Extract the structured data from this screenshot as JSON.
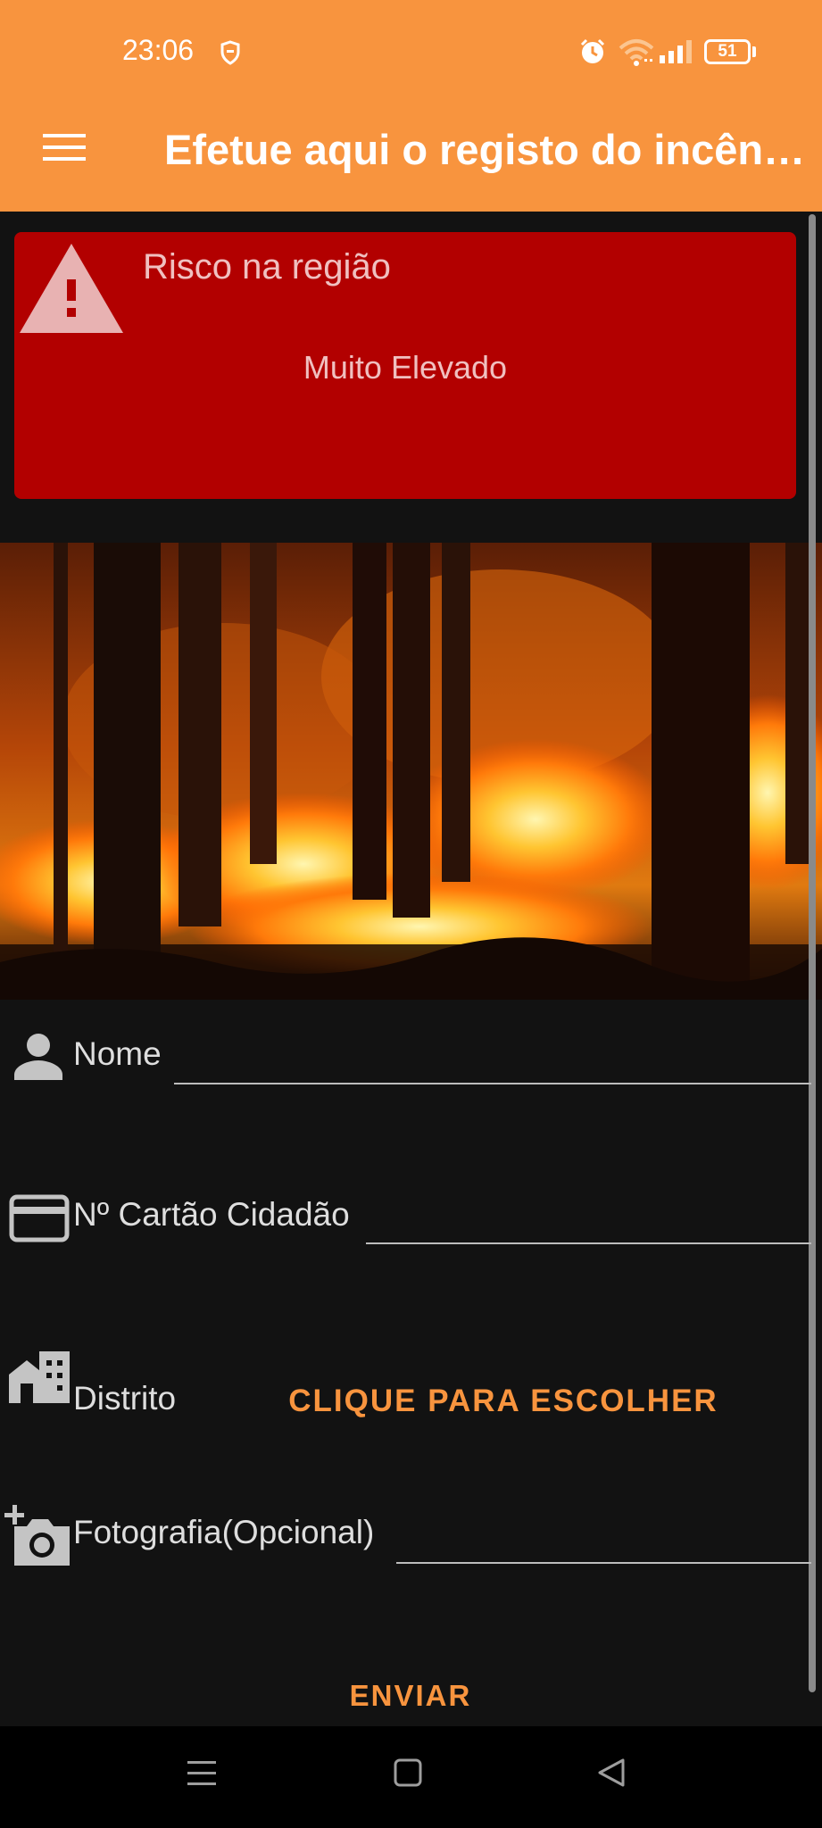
{
  "status_bar": {
    "time": "23:06",
    "battery": "51",
    "icons": [
      "vpn-shield-icon",
      "alarm-icon",
      "wifi-icon",
      "signal-icon",
      "battery-icon"
    ]
  },
  "app_bar": {
    "title": "Efetue aqui o registo do incêndio",
    "menu_icon": "hamburger-menu-icon"
  },
  "risk_card": {
    "title": "Risco na região",
    "level": "Muito Elevado",
    "icon": "warning-icon",
    "background_color": "#b20000"
  },
  "hero_image": {
    "icon": "forest-fire-image"
  },
  "form": {
    "name_label": "Nome",
    "citizen_card_label": "Nº Cartão Cidadão",
    "district_label": "Distrito",
    "district_button": "CLIQUE PARA ESCOLHER",
    "photo_label": "Fotografia(Opcional)",
    "submit": "ENVIAR",
    "icons": [
      "person-icon",
      "card-icon",
      "building-icon",
      "add-photo-icon"
    ]
  },
  "colors": {
    "accent": "#f8943e",
    "background": "#121212",
    "danger": "#b20000"
  },
  "nav_bar": {
    "icons": [
      "recent-apps-icon",
      "home-icon",
      "back-icon"
    ]
  }
}
